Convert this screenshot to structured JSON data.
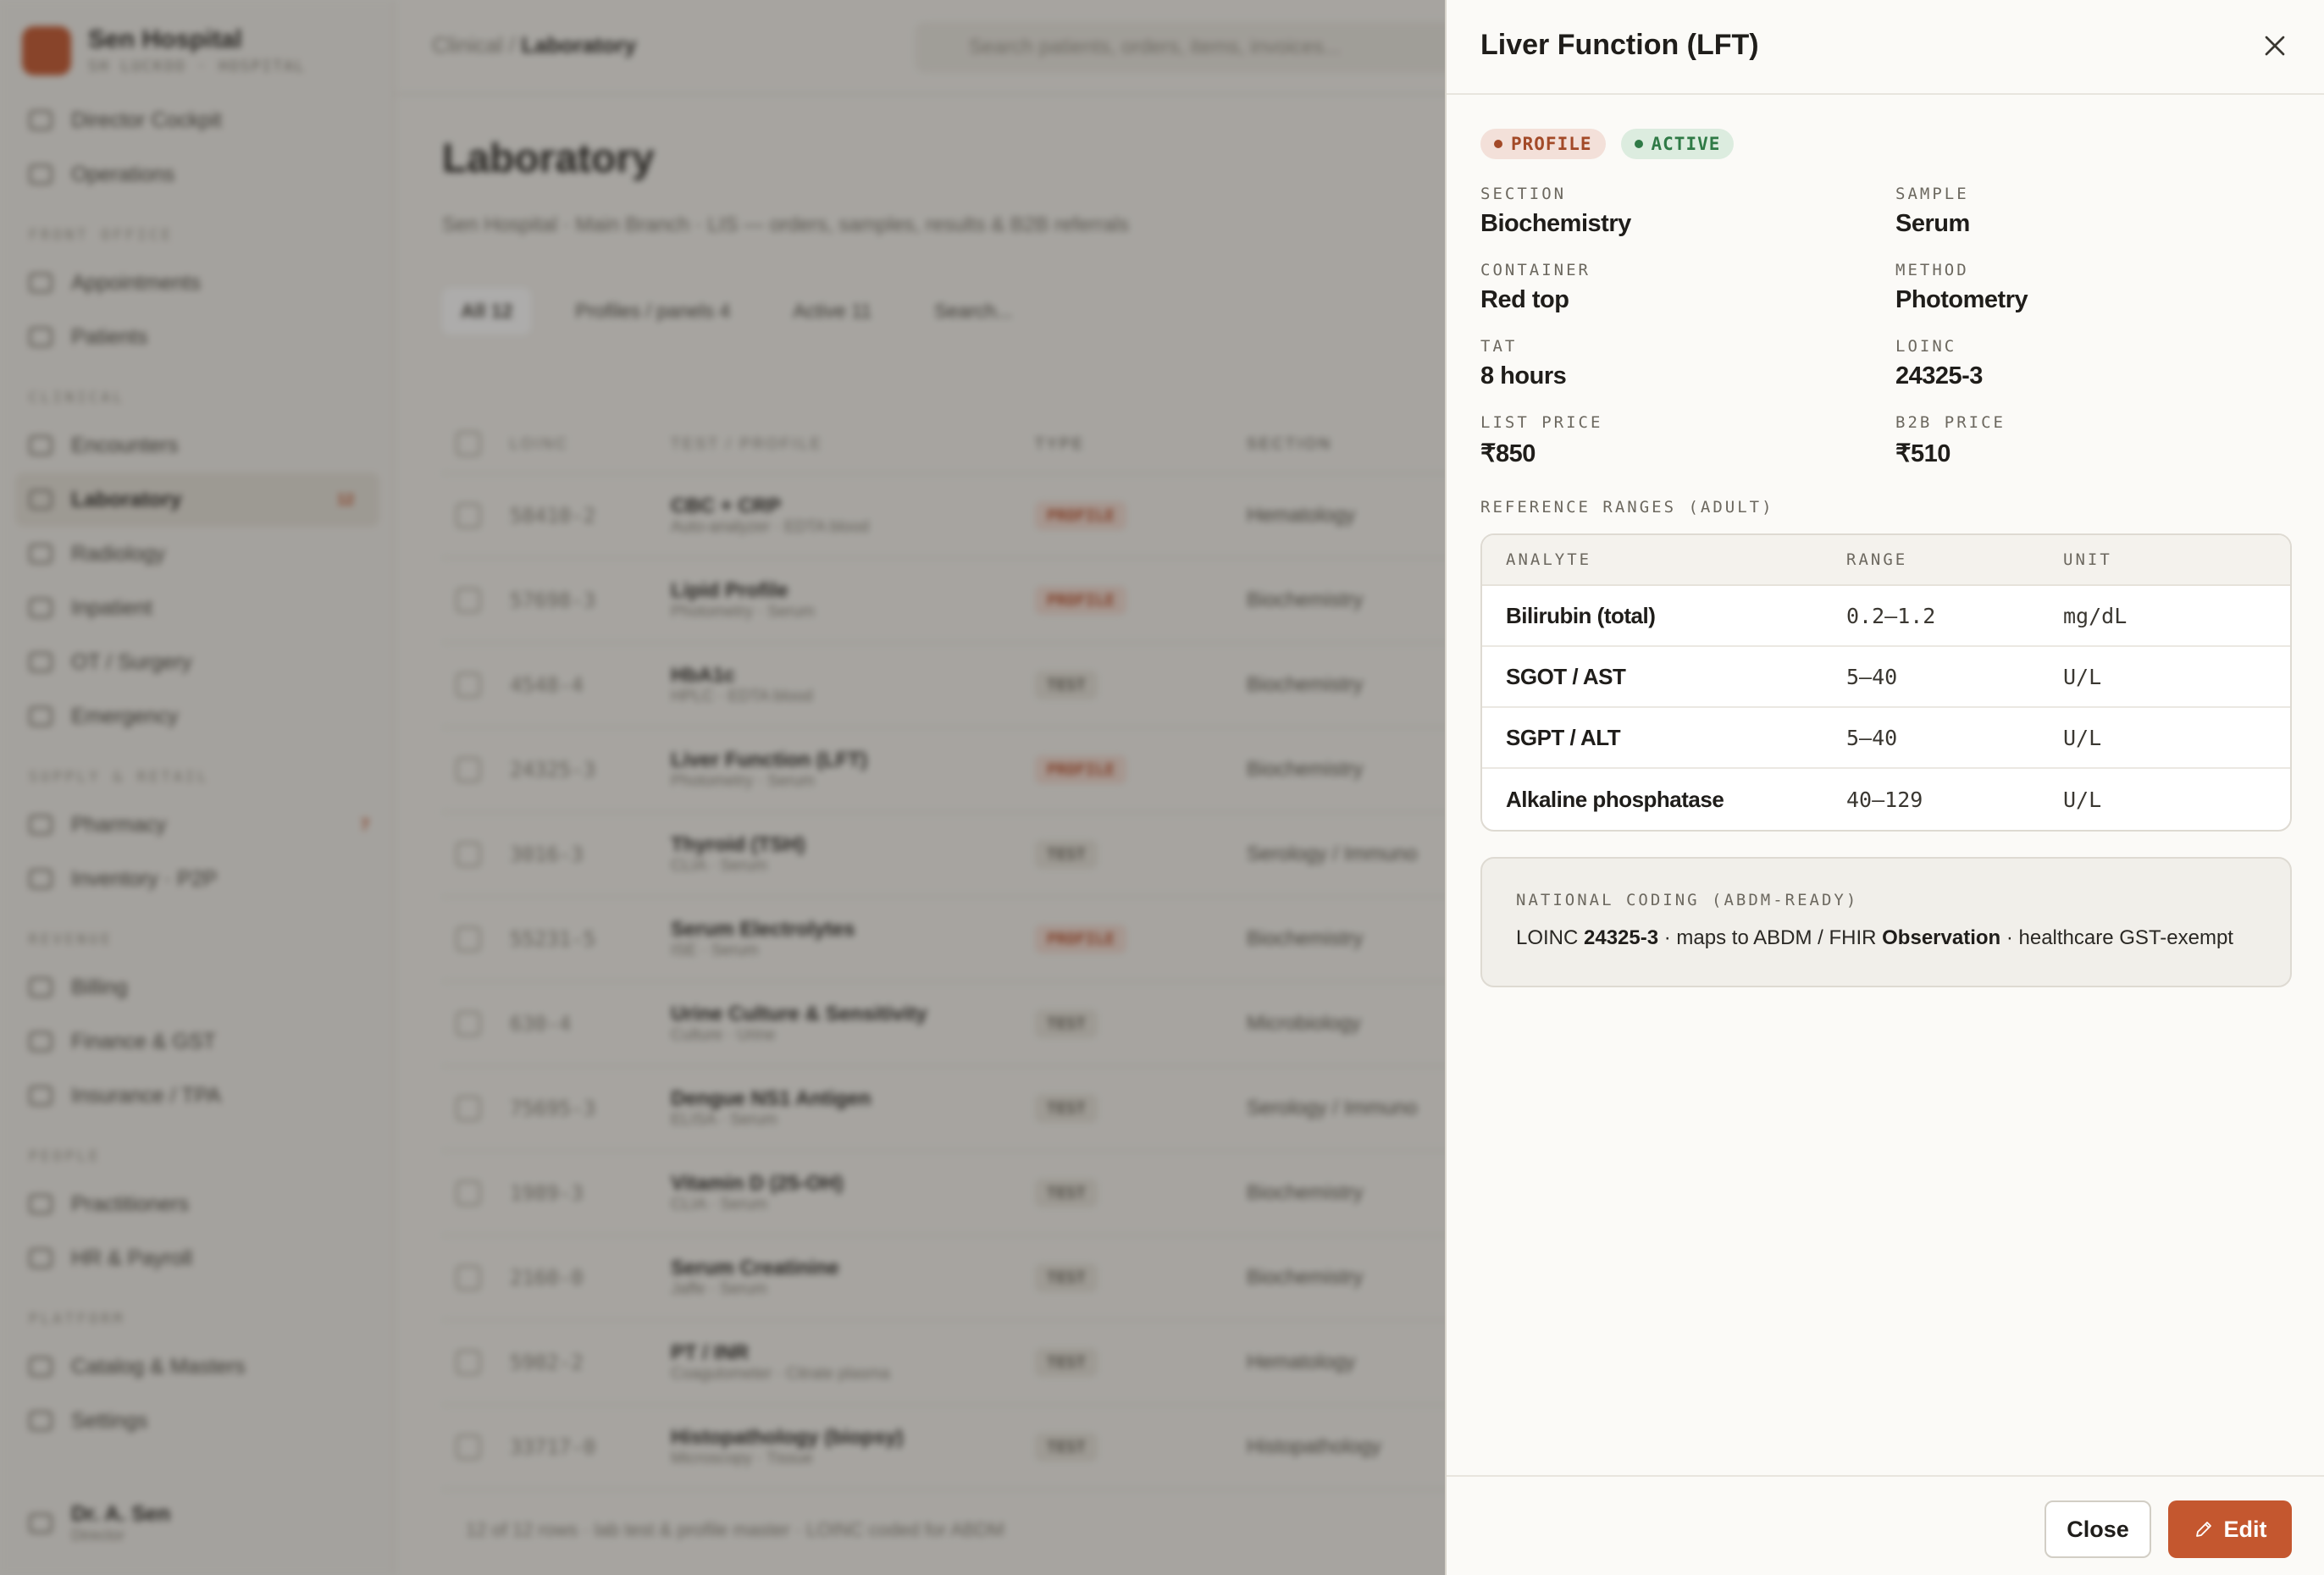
{
  "background": {
    "brand": {
      "name": "Sen Hospital",
      "sub": "SH LUCKOO · HOSPITAL"
    },
    "nav": [
      {
        "type": "item",
        "label": "Director Cockpit"
      },
      {
        "type": "item",
        "label": "Operations"
      },
      {
        "type": "section",
        "label": "FRONT OFFICE"
      },
      {
        "type": "item",
        "label": "Appointments"
      },
      {
        "type": "item",
        "label": "Patients"
      },
      {
        "type": "section",
        "label": "CLINICAL"
      },
      {
        "type": "item",
        "label": "Encounters"
      },
      {
        "type": "item",
        "label": "Laboratory",
        "active": true,
        "badge": "12"
      },
      {
        "type": "item",
        "label": "Radiology"
      },
      {
        "type": "item",
        "label": "Inpatient"
      },
      {
        "type": "item",
        "label": "OT / Surgery"
      },
      {
        "type": "item",
        "label": "Emergency"
      },
      {
        "type": "section",
        "label": "SUPPLY & RETAIL"
      },
      {
        "type": "item",
        "label": "Pharmacy",
        "badge": "7"
      },
      {
        "type": "item",
        "label": "Inventory · P2P"
      },
      {
        "type": "section",
        "label": "REVENUE"
      },
      {
        "type": "item",
        "label": "Billing"
      },
      {
        "type": "item",
        "label": "Finance & GST"
      },
      {
        "type": "item",
        "label": "Insurance / TPA"
      },
      {
        "type": "section",
        "label": "PEOPLE"
      },
      {
        "type": "item",
        "label": "Practitioners"
      },
      {
        "type": "item",
        "label": "HR & Payroll"
      },
      {
        "type": "section",
        "label": "PLATFORM"
      },
      {
        "type": "item",
        "label": "Catalog & Masters"
      },
      {
        "type": "item",
        "label": "Settings"
      }
    ],
    "user": {
      "name": "Dr. A. Sen",
      "role": "Director"
    },
    "breadcrumb": {
      "parent": "Clinical / ",
      "current": "Laboratory"
    },
    "search_placeholder": "Search patients, orders, items, invoices...",
    "page_title": "Laboratory",
    "page_sub": "Sen Hospital · Main Branch · LIS — orders, samples, results & B2B referrals",
    "tabs": [
      "All  12",
      "Profiles / panels  4",
      "Active  11",
      "Search..."
    ],
    "table_headers": [
      "LOINC",
      "TEST / PROFILE",
      "TYPE",
      "SECTION"
    ],
    "rows": [
      {
        "loinc": "58410-2",
        "name": "CBC + CRP",
        "sub": "Auto-analyzer · EDTA blood",
        "type": "PROFILE",
        "section": "Hematology"
      },
      {
        "loinc": "57698-3",
        "name": "Lipid Profile",
        "sub": "Photometry · Serum",
        "type": "PROFILE",
        "section": "Biochemistry"
      },
      {
        "loinc": "4548-4",
        "name": "HbA1c",
        "sub": "HPLC · EDTA blood",
        "type": "TEST",
        "section": "Biochemistry"
      },
      {
        "loinc": "24325-3",
        "name": "Liver Function (LFT)",
        "sub": "Photometry · Serum",
        "type": "PROFILE",
        "section": "Biochemistry"
      },
      {
        "loinc": "3016-3",
        "name": "Thyroid (TSH)",
        "sub": "CLIA · Serum",
        "type": "TEST",
        "section": "Serology / Immuno"
      },
      {
        "loinc": "55231-5",
        "name": "Serum Electrolytes",
        "sub": "ISE · Serum",
        "type": "PROFILE",
        "section": "Biochemistry"
      },
      {
        "loinc": "630-4",
        "name": "Urine Culture & Sensitivity",
        "sub": "Culture · Urine",
        "type": "TEST",
        "section": "Microbiology"
      },
      {
        "loinc": "75695-3",
        "name": "Dengue NS1 Antigen",
        "sub": "ELISA · Serum",
        "type": "TEST",
        "section": "Serology / Immuno"
      },
      {
        "loinc": "1989-3",
        "name": "Vitamin D (25-OH)",
        "sub": "CLIA · Serum",
        "type": "TEST",
        "section": "Biochemistry"
      },
      {
        "loinc": "2160-0",
        "name": "Serum Creatinine",
        "sub": "Jaffe · Serum",
        "type": "TEST",
        "section": "Biochemistry"
      },
      {
        "loinc": "5902-2",
        "name": "PT / INR",
        "sub": "Coagulometer · Citrate plasma",
        "type": "TEST",
        "section": "Hematology"
      },
      {
        "loinc": "33717-0",
        "name": "Histopathology (biopsy)",
        "sub": "Microscopy · Tissue",
        "type": "TEST",
        "section": "Histopathology"
      }
    ],
    "footer": "12 of 12 rows · lab test & profile master · LOINC coded for ABDM"
  },
  "drawer": {
    "title": "Liver Function (LFT)",
    "pills": {
      "type": "PROFILE",
      "status": "ACTIVE"
    },
    "fields": {
      "section": {
        "label": "SECTION",
        "value": "Biochemistry"
      },
      "sample": {
        "label": "SAMPLE",
        "value": "Serum"
      },
      "container": {
        "label": "CONTAINER",
        "value": "Red top"
      },
      "method": {
        "label": "METHOD",
        "value": "Photometry"
      },
      "tat": {
        "label": "TAT",
        "value": "8 hours"
      },
      "loinc": {
        "label": "LOINC",
        "value": "24325-3"
      },
      "list_price": {
        "label": "LIST PRICE",
        "value": "₹850"
      },
      "b2b_price": {
        "label": "B2B PRICE",
        "value": "₹510"
      }
    },
    "ranges": {
      "label": "REFERENCE RANGES (ADULT)",
      "headers": {
        "analyte": "ANALYTE",
        "range": "RANGE",
        "unit": "UNIT"
      },
      "rows": [
        {
          "analyte": "Bilirubin (total)",
          "range": "0.2–1.2",
          "unit": "mg/dL"
        },
        {
          "analyte": "SGOT / AST",
          "range": "5–40",
          "unit": "U/L"
        },
        {
          "analyte": "SGPT / ALT",
          "range": "5–40",
          "unit": "U/L"
        },
        {
          "analyte": "Alkaline phosphatase",
          "range": "40–129",
          "unit": "U/L"
        }
      ]
    },
    "coding": {
      "label": "NATIONAL CODING (ABDM-READY)",
      "prefix": "LOINC ",
      "code": "24325-3",
      "middle": " · maps to ABDM / FHIR ",
      "resource": "Observation",
      "suffix": " · healthcare GST-exempt"
    },
    "buttons": {
      "close": "Close",
      "edit": "Edit"
    }
  }
}
